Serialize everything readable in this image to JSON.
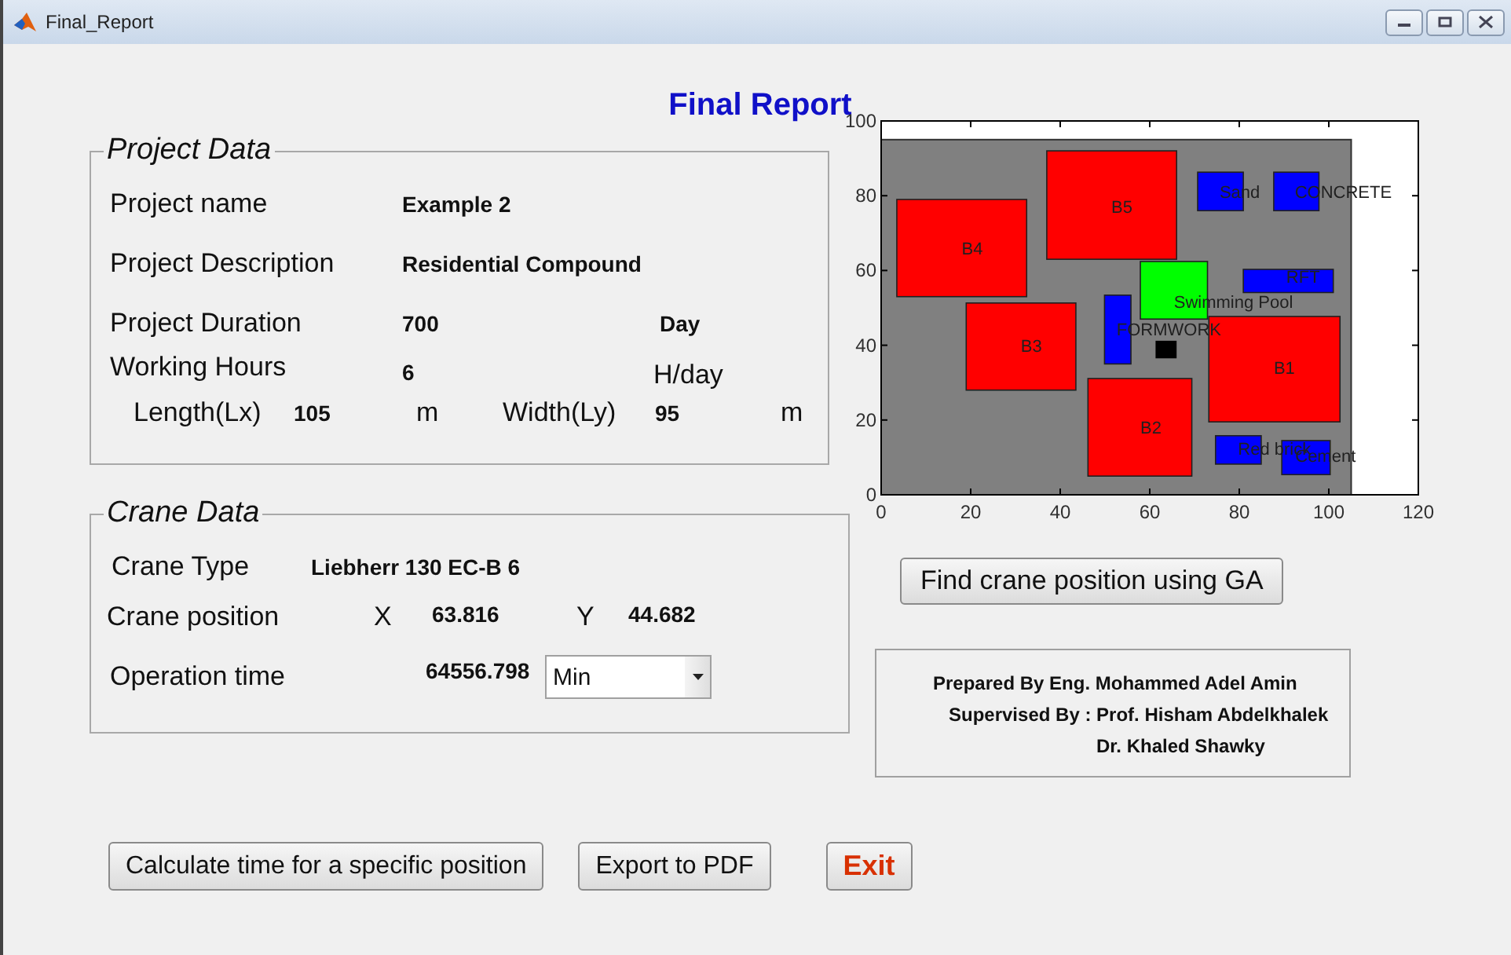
{
  "window": {
    "title": "Final_Report"
  },
  "heading": "Final Report",
  "project_data": {
    "title": "Project Data",
    "name": {
      "label": "Project name",
      "value": "Example 2"
    },
    "description": {
      "label": "Project Description",
      "value": "Residential Compound"
    },
    "duration": {
      "label": "Project Duration",
      "value": "700",
      "unit": "Day"
    },
    "working_hours": {
      "label": "Working Hours",
      "value": "6",
      "unit": "H/day"
    },
    "dimensions": {
      "length_label": "Length(Lx)",
      "length_value": "105",
      "length_unit": "m",
      "width_label": "Width(Ly)",
      "width_value": "95",
      "width_unit": "m"
    }
  },
  "crane_data": {
    "title": "Crane Data",
    "type": {
      "label": "Crane Type",
      "value": "Liebherr 130 EC-B 6"
    },
    "position": {
      "label": "Crane position",
      "x_label": "X",
      "x_value": "63.816",
      "y_label": "Y",
      "y_value": "44.682"
    },
    "operation_time": {
      "label": "Operation time",
      "value": "64556.798",
      "unit": "Min"
    }
  },
  "site_plot": {
    "xticks": [
      "0",
      "20",
      "40",
      "60",
      "80",
      "100",
      "120"
    ],
    "yticks": [
      "100",
      "80",
      "60",
      "40",
      "20",
      "0"
    ],
    "facilities": [
      {
        "label": "B4",
        "color": "#ff0000"
      },
      {
        "label": "B5",
        "color": "#ff0000"
      },
      {
        "label": "B3",
        "color": "#ff0000"
      },
      {
        "label": "B2",
        "color": "#ff0000"
      },
      {
        "label": "B1",
        "color": "#ff0000"
      },
      {
        "label": "Sand",
        "color": "#0000ff"
      },
      {
        "label": "CONCRETE",
        "color": "#0000ff"
      },
      {
        "label": "RFT",
        "color": "#0000ff"
      },
      {
        "label": "Swimming Pool",
        "color": "#00ff00"
      },
      {
        "label": "FORMWORK",
        "color": "#0000ff"
      },
      {
        "label": "Red brick",
        "color": "#0000ff"
      },
      {
        "label": "Cement",
        "color": "#0000ff"
      }
    ]
  },
  "find_button": "Find crane position using GA",
  "credits": [
    "Prepared By Eng. Mohammed Adel Amin",
    "Supervised By : Prof. Hisham Abdelkhalek",
    "Dr. Khaled Shawky"
  ],
  "buttons": [
    {
      "label": "Calculate time for a specific position",
      "kind": "normal"
    },
    {
      "label": "Export to PDF",
      "kind": "normal"
    },
    {
      "label": "Exit",
      "kind": "exit"
    }
  ]
}
